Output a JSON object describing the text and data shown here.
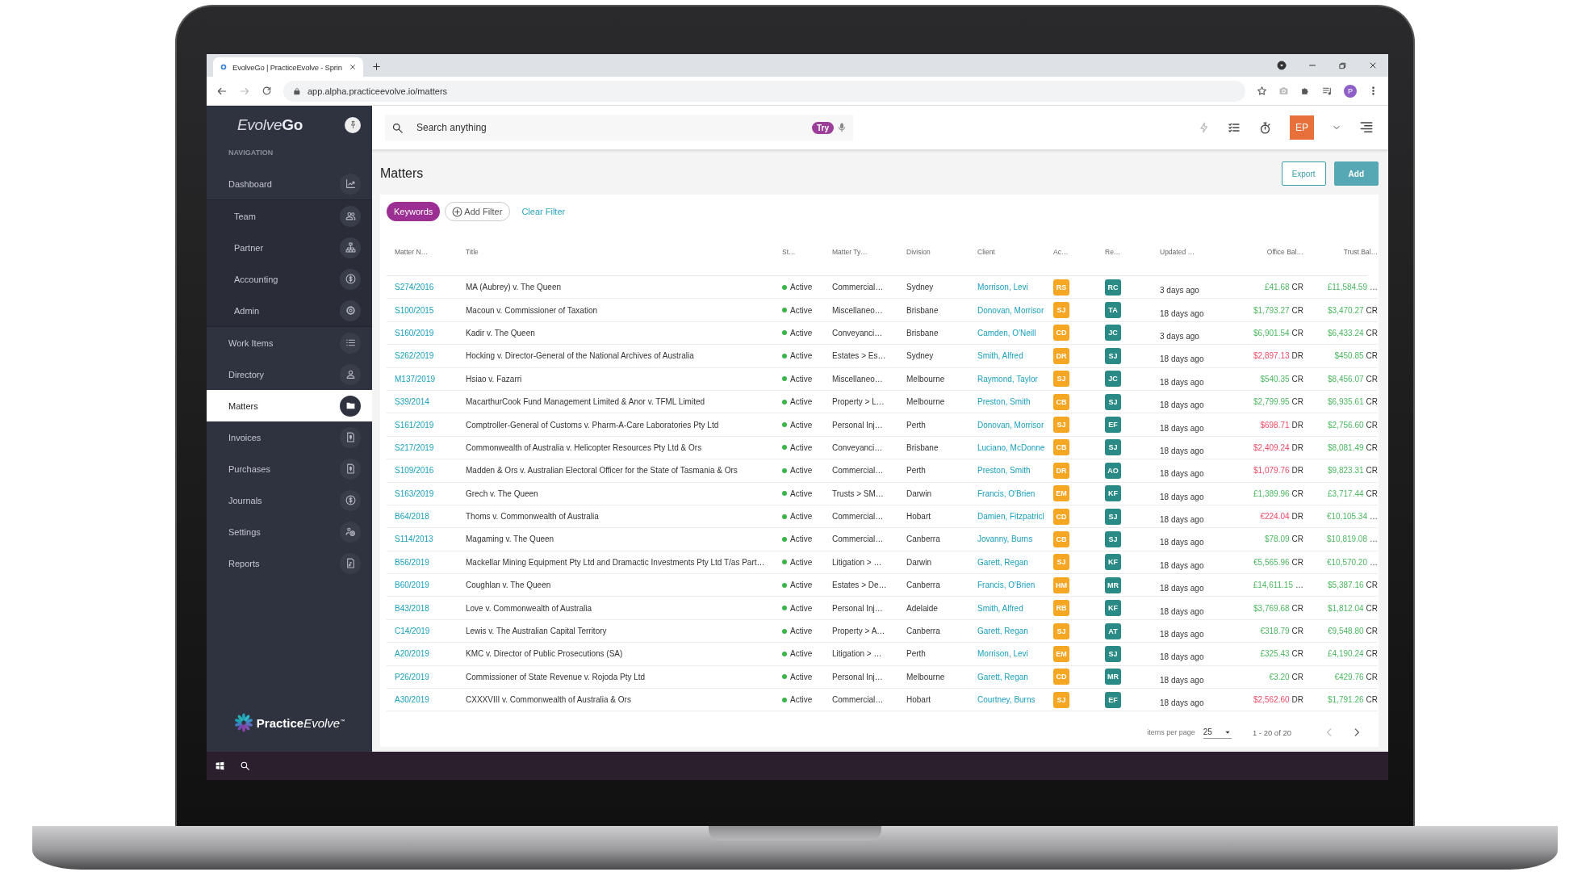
{
  "browser": {
    "tab_title": "EvolveGo | PracticeEvolve - Sprin",
    "url": "app.alpha.practiceevolve.io/matters",
    "profile": "P"
  },
  "sidebar": {
    "logo": "Evolve**Go**",
    "heading": "NAVIGATION",
    "items": [
      {
        "label": "Dashboard",
        "selected": false,
        "expanded": true,
        "children": [
          {
            "label": "Team",
            "selected": false
          },
          {
            "label": "Partner",
            "selected": false
          },
          {
            "label": "Accounting",
            "selected": false
          },
          {
            "label": "Admin",
            "selected": false
          }
        ]
      },
      {
        "label": "Work Items",
        "selected": false
      },
      {
        "label": "Directory",
        "selected": false
      },
      {
        "label": "Matters",
        "selected": true
      },
      {
        "label": "Invoices",
        "selected": false
      },
      {
        "label": "Purchases",
        "selected": false
      },
      {
        "label": "Journals",
        "selected": false
      },
      {
        "label": "Settings",
        "selected": false
      },
      {
        "label": "Reports",
        "selected": false
      }
    ],
    "footer_logo": "**Practice**Evolve$^{™}$"
  },
  "header": {
    "search": {
      "placeholder": "Search anything",
      "badge": "Try"
    },
    "avatar": "EP"
  },
  "page": {
    "title": "Matters",
    "buttons": [
      {
        "label": "Export",
        "kind": "outline"
      },
      {
        "label": "Add",
        "kind": "primary"
      }
    ],
    "filters": {
      "keywords": "Keywords",
      "add": "Add Filter",
      "clear": "Clear Filter"
    }
  },
  "table": {
    "columns": [
      "Matter N…",
      "Title",
      "St…",
      "Matter Ty…",
      "Division",
      "Client",
      "Ac…",
      "Re…",
      "Updated …",
      "Office Bal…",
      "Trust Bal…"
    ],
    "rows": [
      {
        "matter": "S274/2016",
        "title": "MA (Aubrey) v. The Queen",
        "status": "Active",
        "matter_type": "Commercial…",
        "division": "Sydney",
        "client": "Morrison, Levi",
        "acting": "RS",
        "responsible": "RC",
        "updated": "3 days ago",
        "office": {
          "amount": "£41.68",
          "suffix": "CR",
          "kind": "credit"
        },
        "trust": {
          "amount": "£11,584.59",
          "suffix": "…",
          "kind": "credit"
        }
      },
      {
        "matter": "S100/2015",
        "title": "Macoun v. Commissioner of Taxation",
        "status": "Active",
        "matter_type": "Miscellaneo…",
        "division": "Brisbane",
        "client": "Donovan, Morrisor",
        "acting": "SJ",
        "responsible": "TA",
        "updated": "18 days ago",
        "office": {
          "amount": "$1,793.27",
          "suffix": "CR",
          "kind": "credit"
        },
        "trust": {
          "amount": "$3,470.27",
          "suffix": "CR",
          "kind": "credit"
        }
      },
      {
        "matter": "S160/2019",
        "title": "Kadir v. The Queen",
        "status": "Active",
        "matter_type": "Conveyanci…",
        "division": "Brisbane",
        "client": "Camden, O'Neill",
        "acting": "CD",
        "responsible": "JC",
        "updated": "3 days ago",
        "office": {
          "amount": "$6,901.54",
          "suffix": "CR",
          "kind": "credit"
        },
        "trust": {
          "amount": "$6,433.24",
          "suffix": "CR",
          "kind": "credit"
        }
      },
      {
        "matter": "S262/2019",
        "title": "Hocking v. Director-General of the National Archives of Australia",
        "status": "Active",
        "matter_type": "Estates > Es…",
        "division": "Sydney",
        "client": "Smith, Alfred",
        "acting": "DR",
        "responsible": "SJ",
        "updated": "18 days ago",
        "office": {
          "amount": "$2,897.13",
          "suffix": "DR",
          "kind": "debit"
        },
        "trust": {
          "amount": "$450.85",
          "suffix": "CR",
          "kind": "credit"
        }
      },
      {
        "matter": "M137/2019",
        "title": "Hsiao v. Fazarri",
        "status": "Active",
        "matter_type": "Miscellaneo…",
        "division": "Melbourne",
        "client": "Raymond, Taylor",
        "acting": "SJ",
        "responsible": "JC",
        "updated": "18 days ago",
        "office": {
          "amount": "$540.35",
          "suffix": "CR",
          "kind": "credit"
        },
        "trust": {
          "amount": "$8,456.07",
          "suffix": "CR",
          "kind": "credit"
        }
      },
      {
        "matter": "S39/2014",
        "title": "MacarthurCook Fund Management Limited & Anor v. TFML Limited",
        "status": "Active",
        "matter_type": "Property > L…",
        "division": "Melbourne",
        "client": "Preston, Smith",
        "acting": "CB",
        "responsible": "SJ",
        "updated": "18 days ago",
        "office": {
          "amount": "$2,799.95",
          "suffix": "CR",
          "kind": "credit"
        },
        "trust": {
          "amount": "$6,935.61",
          "suffix": "CR",
          "kind": "credit"
        }
      },
      {
        "matter": "S161/2019",
        "title": "Comptroller-General of Customs v. Pharm-A-Care Laboratories Pty Ltd",
        "status": "Active",
        "matter_type": "Personal Inj…",
        "division": "Perth",
        "client": "Donovan, Morrisor",
        "acting": "SJ",
        "responsible": "EF",
        "updated": "18 days ago",
        "office": {
          "amount": "$698.71",
          "suffix": "DR",
          "kind": "debit"
        },
        "trust": {
          "amount": "$2,756.60",
          "suffix": "CR",
          "kind": "credit"
        }
      },
      {
        "matter": "S217/2019",
        "title": "Commonwealth of Australia v. Helicopter Resources Pty Ltd & Ors",
        "status": "Active",
        "matter_type": "Conveyanci…",
        "division": "Brisbane",
        "client": "Luciano, McDonne",
        "acting": "CB",
        "responsible": "SJ",
        "updated": "18 days ago",
        "office": {
          "amount": "$2,409.24",
          "suffix": "DR",
          "kind": "debit"
        },
        "trust": {
          "amount": "$8,081.49",
          "suffix": "CR",
          "kind": "credit"
        }
      },
      {
        "matter": "S109/2016",
        "title": "Madden & Ors v. Australian Electoral Officer for the State of Tasmania & Ors",
        "status": "Active",
        "matter_type": "Commercial…",
        "division": "Perth",
        "client": "Preston, Smith",
        "acting": "DR",
        "responsible": "AO",
        "updated": "18 days ago",
        "office": {
          "amount": "$1,079.76",
          "suffix": "DR",
          "kind": "debit"
        },
        "trust": {
          "amount": "$9,823.31",
          "suffix": "CR",
          "kind": "credit"
        }
      },
      {
        "matter": "S163/2019",
        "title": "Grech v. The Queen",
        "status": "Active",
        "matter_type": "Trusts > SM…",
        "division": "Darwin",
        "client": "Francis, O'Brien",
        "acting": "EM",
        "responsible": "KF",
        "updated": "18 days ago",
        "office": {
          "amount": "£1,389.96",
          "suffix": "CR",
          "kind": "credit"
        },
        "trust": {
          "amount": "£3,717.44",
          "suffix": "CR",
          "kind": "credit"
        }
      },
      {
        "matter": "B64/2018",
        "title": "Thoms v. Commonwealth of Australia",
        "status": "Active",
        "matter_type": "Commercial…",
        "division": "Hobart",
        "client": "Damien, Fitzpatricl",
        "acting": "CD",
        "responsible": "SJ",
        "updated": "18 days ago",
        "office": {
          "amount": "€224.04",
          "suffix": "DR",
          "kind": "debit"
        },
        "trust": {
          "amount": "€10,105.34",
          "suffix": "…",
          "kind": "credit"
        }
      },
      {
        "matter": "S114/2013",
        "title": "Magaming v. The Queen",
        "status": "Active",
        "matter_type": "Commercial…",
        "division": "Canberra",
        "client": "Jovanny, Burns",
        "acting": "CB",
        "responsible": "SJ",
        "updated": "18 days ago",
        "office": {
          "amount": "$78.09",
          "suffix": "CR",
          "kind": "credit"
        },
        "trust": {
          "amount": "$10,819.08",
          "suffix": "…",
          "kind": "credit"
        }
      },
      {
        "matter": "B56/2019",
        "title": "Mackellar Mining Equipment Pty Ltd and Dramactic Investments Pty Ltd T/as Part…",
        "status": "Active",
        "matter_type": "Litigation > …",
        "division": "Darwin",
        "client": "Garett, Regan",
        "acting": "SJ",
        "responsible": "KF",
        "updated": "18 days ago",
        "office": {
          "amount": "€5,565.96",
          "suffix": "CR",
          "kind": "credit"
        },
        "trust": {
          "amount": "€10,570.20",
          "suffix": "…",
          "kind": "credit"
        }
      },
      {
        "matter": "B60/2019",
        "title": "Coughlan v. The Queen",
        "status": "Active",
        "matter_type": "Estates > De…",
        "division": "Canberra",
        "client": "Francis, O'Brien",
        "acting": "HM",
        "responsible": "MR",
        "updated": "18 days ago",
        "office": {
          "amount": "£14,611.15",
          "suffix": "…",
          "kind": "credit"
        },
        "trust": {
          "amount": "$5,387.16",
          "suffix": "CR",
          "kind": "credit"
        }
      },
      {
        "matter": "B43/2018",
        "title": "Love v. Commonwealth of Australia",
        "status": "Active",
        "matter_type": "Personal Inj…",
        "division": "Adelaide",
        "client": "Smith, Alfred",
        "acting": "RB",
        "responsible": "KF",
        "updated": "18 days ago",
        "office": {
          "amount": "$3,769.68",
          "suffix": "CR",
          "kind": "credit"
        },
        "trust": {
          "amount": "$1,812.04",
          "suffix": "CR",
          "kind": "credit"
        }
      },
      {
        "matter": "C14/2019",
        "title": "Lewis v. The Australian Capital Territory",
        "status": "Active",
        "matter_type": "Property > A…",
        "division": "Canberra",
        "client": "Garett, Regan",
        "acting": "SJ",
        "responsible": "AT",
        "updated": "18 days ago",
        "office": {
          "amount": "€318.79",
          "suffix": "CR",
          "kind": "credit"
        },
        "trust": {
          "amount": "€9,548.80",
          "suffix": "CR",
          "kind": "credit"
        }
      },
      {
        "matter": "A20/2019",
        "title": "KMC v. Director of Public Prosecutions (SA)",
        "status": "Active",
        "matter_type": "Litigation > …",
        "division": "Perth",
        "client": "Morrison, Levi",
        "acting": "EM",
        "responsible": "SJ",
        "updated": "18 days ago",
        "office": {
          "amount": "£325.43",
          "suffix": "CR",
          "kind": "credit"
        },
        "trust": {
          "amount": "£4,190.24",
          "suffix": "CR",
          "kind": "credit"
        }
      },
      {
        "matter": "P26/2019",
        "title": "Commissioner of State Revenue v. Rojoda Pty Ltd",
        "status": "Active",
        "matter_type": "Personal Inj…",
        "division": "Melbourne",
        "client": "Garett, Regan",
        "acting": "CD",
        "responsible": "MR",
        "updated": "18 days ago",
        "office": {
          "amount": "€3.20",
          "suffix": "CR",
          "kind": "credit"
        },
        "trust": {
          "amount": "€429.76",
          "suffix": "CR",
          "kind": "credit"
        }
      },
      {
        "matter": "A30/2019",
        "title": "CXXXVIII v. Commonwealth of Australia & Ors",
        "status": "Active",
        "matter_type": "Commercial…",
        "division": "Hobart",
        "client": "Courtney, Burns",
        "acting": "SJ",
        "responsible": "EF",
        "updated": "18 days ago",
        "office": {
          "amount": "$2,562.60",
          "suffix": "DR",
          "kind": "debit"
        },
        "trust": {
          "amount": "$1,791.26",
          "suffix": "CR",
          "kind": "credit"
        }
      }
    ]
  },
  "pagination": {
    "label": "items per page",
    "page_size": "25",
    "range": "1 - 20 of 20"
  }
}
